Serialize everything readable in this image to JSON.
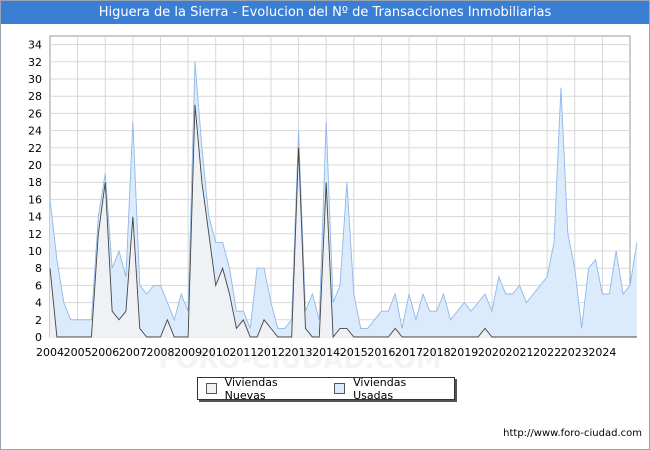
{
  "title": "Higuera de la Sierra - Evolucion del Nº de Transacciones Inmobiliarias",
  "source": "http://www.foro-ciudad.com",
  "watermark": "FORO-CIUDAD.COM",
  "colors": {
    "title_bg": "#3b7fd4",
    "usadas_fill": "#dcebfb",
    "usadas_line": "#8fb8e8",
    "nuevas_fill": "#f2f2f2",
    "nuevas_line": "#444444",
    "grid": "#d8d8d8"
  },
  "chart_data": {
    "type": "area",
    "title": "Higuera de la Sierra - Evolucion del Nº de Transacciones Inmobiliarias",
    "xlabel": "",
    "ylabel": "",
    "ylim": [
      0,
      35
    ],
    "yticks": [
      0,
      2,
      4,
      6,
      8,
      10,
      12,
      14,
      16,
      18,
      20,
      22,
      24,
      26,
      28,
      30,
      32,
      34
    ],
    "years": [
      "2004",
      "2005",
      "2006",
      "2007",
      "2008",
      "2009",
      "2010",
      "2011",
      "2012",
      "2013",
      "2014",
      "2015",
      "2016",
      "2017",
      "2018",
      "2019",
      "2020",
      "2021",
      "2022",
      "2023",
      "2024"
    ],
    "x_start": 2004,
    "periods_per_year": 4,
    "grid": true,
    "legend_position": "bottom",
    "series": [
      {
        "name": "Viviendas Usadas",
        "values": [
          16,
          9,
          4,
          2,
          2,
          2,
          2,
          14,
          19,
          8,
          10,
          7,
          25,
          6,
          5,
          6,
          6,
          4,
          2,
          5,
          3,
          32,
          22,
          14,
          11,
          11,
          8,
          3,
          3,
          1,
          8,
          8,
          4,
          1,
          1,
          2,
          24,
          3,
          5,
          2,
          25,
          4,
          6,
          18,
          5,
          1,
          1,
          2,
          3,
          3,
          5,
          1,
          5,
          2,
          5,
          3,
          3,
          5,
          2,
          3,
          4,
          3,
          4,
          5,
          3,
          7,
          5,
          5,
          6,
          4,
          5,
          6,
          7,
          11,
          29,
          12,
          8,
          1,
          8,
          9,
          5,
          5,
          10,
          5,
          6,
          11
        ]
      },
      {
        "name": "Viviendas Nuevas",
        "values": [
          8,
          0,
          0,
          0,
          0,
          0,
          0,
          12,
          18,
          3,
          2,
          3,
          14,
          1,
          0,
          0,
          0,
          2,
          0,
          0,
          0,
          27,
          18,
          12,
          6,
          8,
          5,
          1,
          2,
          0,
          0,
          2,
          1,
          0,
          0,
          0,
          22,
          1,
          0,
          0,
          18,
          0,
          1,
          1,
          0,
          0,
          0,
          0,
          0,
          0,
          1,
          0,
          0,
          0,
          0,
          0,
          0,
          0,
          0,
          0,
          0,
          0,
          0,
          1,
          0,
          0,
          0,
          0,
          0,
          0,
          0,
          0,
          0,
          0,
          0,
          0,
          0,
          0,
          0,
          0,
          0,
          0,
          0,
          0,
          0,
          0
        ]
      }
    ]
  }
}
